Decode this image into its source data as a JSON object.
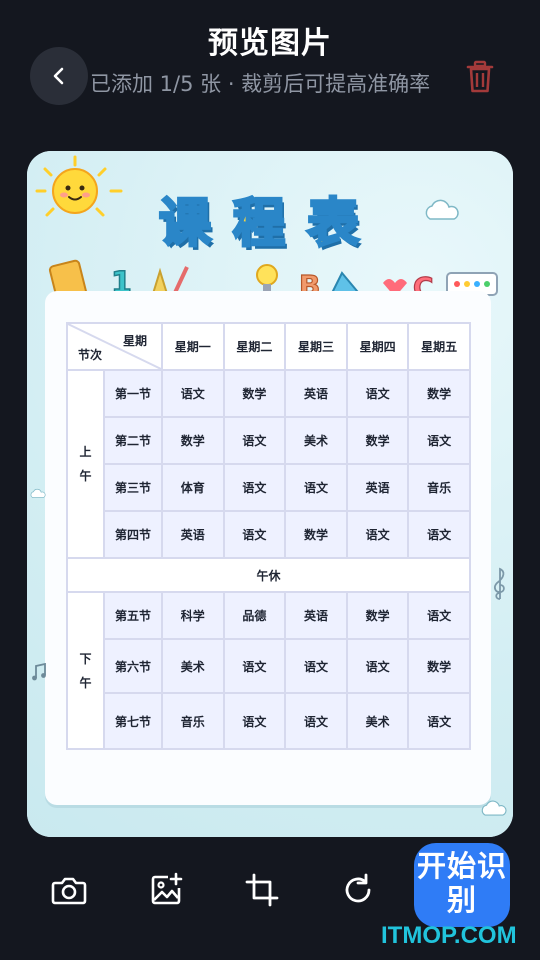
{
  "header": {
    "title": "预览图片"
  },
  "subtitle": "已添加 1/5 张 · 裁剪后可提高准确率",
  "icons": {
    "back": "chevron-left-icon",
    "delete": "trash-icon",
    "camera": "camera-icon",
    "add_image": "image-add-icon",
    "crop": "crop-icon",
    "rotate": "rotate-icon"
  },
  "colors": {
    "background": "#14171f",
    "accent": "#2f7cf6",
    "delete": "#a33a3a"
  },
  "schedule": {
    "title": "课程表",
    "corner_top": "星期",
    "corner_bottom": "节次",
    "days": [
      "星期一",
      "星期二",
      "星期三",
      "星期四",
      "星期五"
    ],
    "morning_label": "上午",
    "afternoon_label": "下午",
    "noon_break": "午休",
    "periods": [
      {
        "label": "第一节",
        "subjects": [
          "语文",
          "数学",
          "英语",
          "语文",
          "数学"
        ]
      },
      {
        "label": "第二节",
        "subjects": [
          "数学",
          "语文",
          "美术",
          "数学",
          "语文"
        ]
      },
      {
        "label": "第三节",
        "subjects": [
          "体育",
          "语文",
          "语文",
          "英语",
          "音乐"
        ]
      },
      {
        "label": "第四节",
        "subjects": [
          "英语",
          "语文",
          "数学",
          "语文",
          "语文"
        ]
      },
      {
        "label": "第五节",
        "subjects": [
          "科学",
          "品德",
          "英语",
          "数学",
          "语文"
        ]
      },
      {
        "label": "第六节",
        "subjects": [
          "美术",
          "语文",
          "语文",
          "语文",
          "数学"
        ]
      },
      {
        "label": "第七节",
        "subjects": [
          "音乐",
          "语文",
          "语文",
          "美术",
          "语文"
        ]
      }
    ]
  },
  "actions": {
    "start": "开始识别"
  },
  "watermark": "ITMOP.COM"
}
